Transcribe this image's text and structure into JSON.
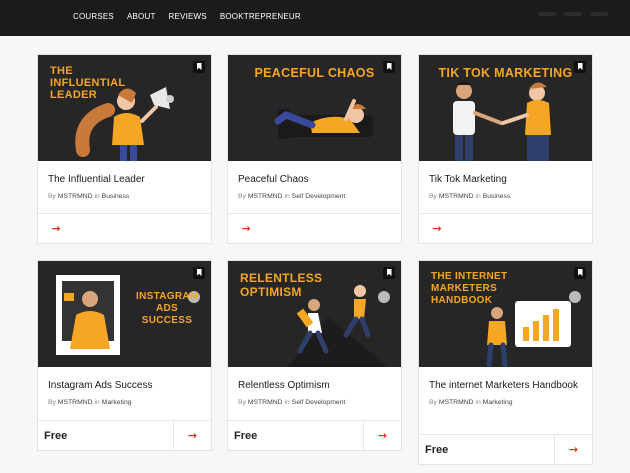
{
  "nav": {
    "items": [
      "COURSES",
      "ABOUT",
      "REVIEWS",
      "BOOKTREPRENEUR"
    ]
  },
  "cards": [
    {
      "thumb_title": "THE INFLUENTIAL LEADER",
      "title": "The Influential Leader",
      "by": "By",
      "author": "MSTRMND",
      "in": "in",
      "category": "Business",
      "price": "",
      "arrow": "→"
    },
    {
      "thumb_title": "PEACEFUL CHAOS",
      "title": "Peaceful Chaos",
      "by": "By",
      "author": "MSTRMND",
      "in": "in",
      "category": "Self Development",
      "price": "",
      "arrow": "→"
    },
    {
      "thumb_title": "TIK TOK MARKETING",
      "title": "Tik Tok Marketing",
      "by": "By",
      "author": "MSTRMND",
      "in": "in",
      "category": "Business",
      "price": "",
      "arrow": "→"
    },
    {
      "thumb_title": "INSTAGRAM ADS SUCCESS",
      "title": "Instagram Ads Success",
      "by": "By",
      "author": "MSTRMND",
      "in": "in",
      "category": "Marketing",
      "price": "Free",
      "arrow": "→"
    },
    {
      "thumb_title": "RELENTLESS OPTIMISM",
      "title": "Relentless Optimism",
      "by": "By",
      "author": "MSTRMND",
      "in": "in",
      "category": "Self Development",
      "price": "Free",
      "arrow": "→"
    },
    {
      "thumb_title": "THE INTERNET MARKETERS HANDBOOK",
      "title": "The internet Marketers Handbook",
      "by": "By",
      "author": "MSTRMND",
      "in": "in",
      "category": "Marketing",
      "price": "Free",
      "arrow": "→"
    }
  ],
  "colors": {
    "accent": "#f5a623",
    "arrow": "#e0341e",
    "dark": "#262626"
  }
}
